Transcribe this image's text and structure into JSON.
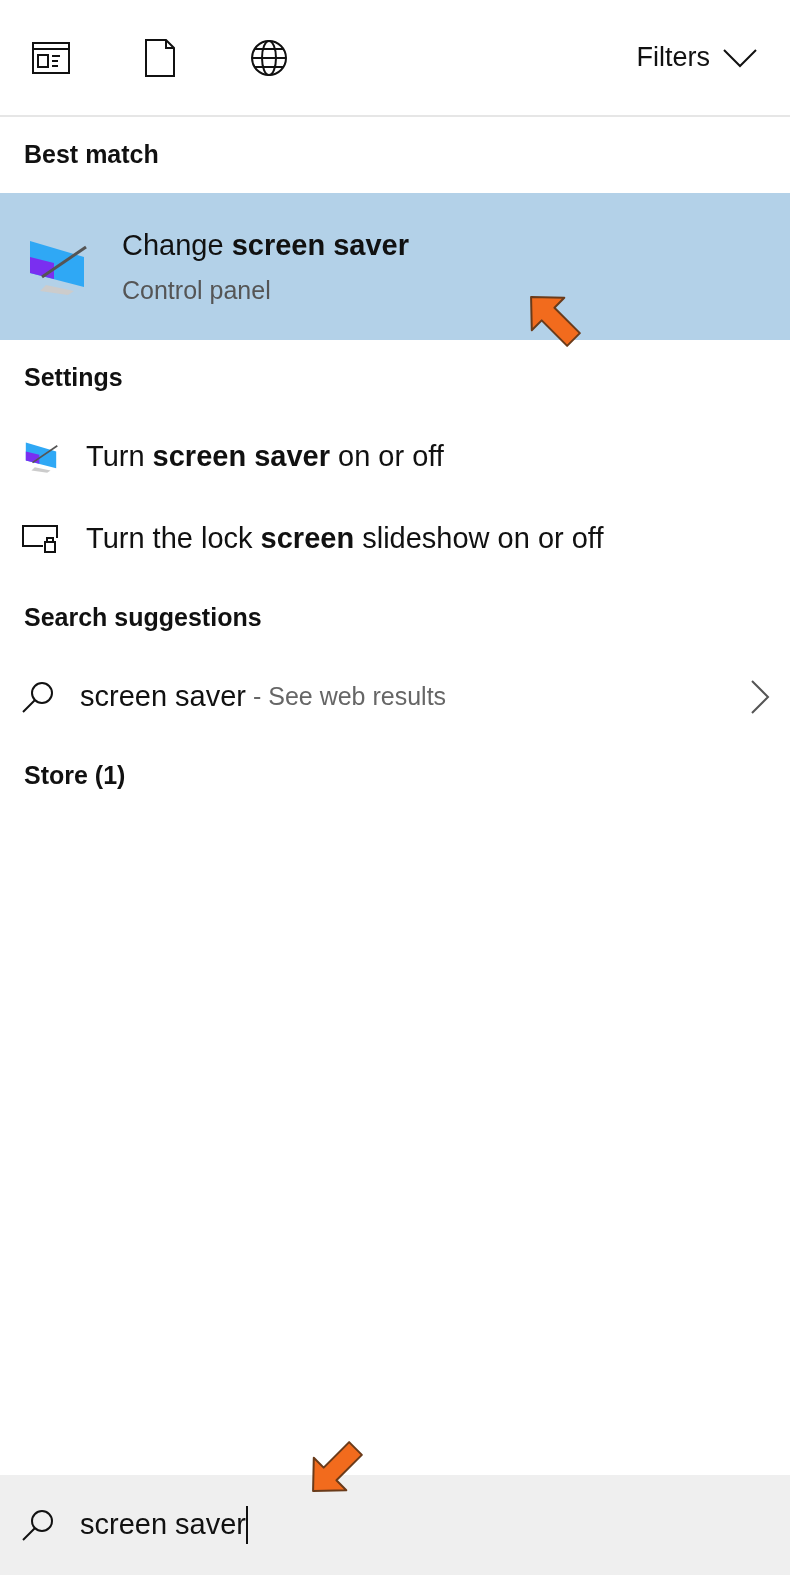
{
  "toolbar": {
    "filters": "Filters"
  },
  "sections": [
    {
      "heading": "Best match",
      "items": [
        {
          "kind": "app",
          "title": "Change **screen saver**",
          "subtitle": "Control panel",
          "selected": true
        }
      ]
    },
    {
      "heading": "Settings",
      "items": [
        {
          "kind": "setting",
          "title": "Turn **screen saver** on or off",
          "selected": false
        },
        {
          "kind": "setting",
          "title": "Turn the lock **screen** slideshow on or off",
          "selected": false
        }
      ]
    },
    {
      "heading": "Search suggestions",
      "items": [
        {
          "kind": "web",
          "title": "screen saver",
          "hint": " - See web results",
          "selected": false
        }
      ]
    },
    {
      "heading": "Store (1)"
    }
  ],
  "search": {
    "value": "screen saver"
  }
}
